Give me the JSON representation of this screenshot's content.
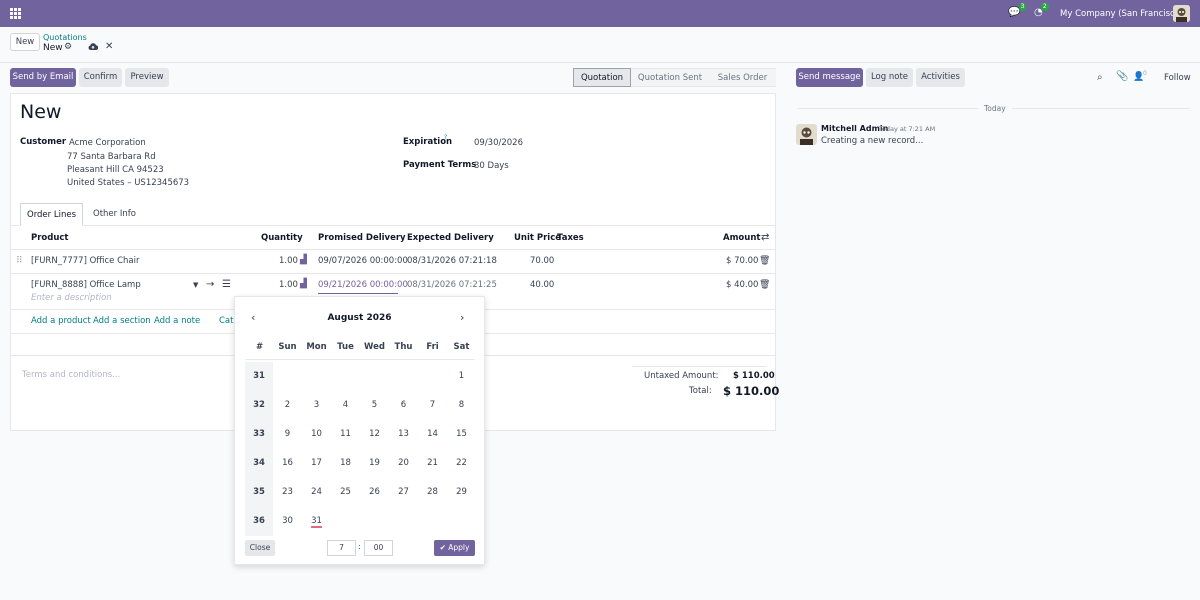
{
  "navbar": {
    "chat_badge": "3",
    "activity_badge": "2",
    "company": "My Company (San Francisco)"
  },
  "control_panel": {
    "new_label": "New",
    "breadcrumb_parent": "Quotations",
    "breadcrumb_current": "New",
    "buttons": {
      "send_email": "Send by Email",
      "confirm": "Confirm",
      "preview": "Preview"
    },
    "status_steps": [
      "Quotation",
      "Quotation Sent",
      "Sales Order"
    ]
  },
  "form": {
    "title": "New",
    "customer_label": "Customer",
    "customer_name": "Acme Corporation",
    "customer_address": [
      "77 Santa Barbara Rd",
      "Pleasant Hill CA 94523",
      "United States – US12345673"
    ],
    "expiration_label": "Expiration",
    "expiration_help": "?",
    "expiration_value": "09/30/2026",
    "payment_terms_label": "Payment Terms",
    "payment_terms_value": "30 Days",
    "tabs": [
      "Order Lines",
      "Other Info"
    ],
    "columns": {
      "product": "Product",
      "quantity": "Quantity",
      "promised": "Promised Delivery",
      "expected": "Expected Delivery",
      "unit_price": "Unit Price",
      "taxes": "Taxes",
      "amount": "Amount"
    },
    "lines": [
      {
        "product": "[FURN_7777] Office Chair",
        "quantity": "1.00",
        "promised": "09/07/2026 00:00:00",
        "expected": "08/31/2026 07:21:18",
        "unit_price": "70.00",
        "amount": "$ 70.00"
      },
      {
        "product": "[FURN_8888] Office Lamp",
        "description_placeholder": "Enter a description",
        "quantity": "1.00",
        "promised": "09/21/2026 00:00:00",
        "expected": "08/31/2026 07:21:25",
        "unit_price": "40.00",
        "amount": "$ 40.00"
      }
    ],
    "add_links": {
      "product": "Add a product",
      "section": "Add a section",
      "note": "Add a note",
      "catalog": "Catalog"
    },
    "terms_placeholder": "Terms and conditions...",
    "untaxed_label": "Untaxed Amount:",
    "untaxed_value": "$ 110.00",
    "total_label": "Total:",
    "total_value": "$ 110.00"
  },
  "chatter": {
    "send_message": "Send message",
    "log_note": "Log note",
    "activities": "Activities",
    "followers_count": "0",
    "follow": "Follow",
    "today": "Today",
    "author": "Mitchell Admin",
    "time": "Today at 7:21 AM",
    "message": "Creating a new record..."
  },
  "datepicker": {
    "month": "August 2026",
    "week_header": "#",
    "days": [
      "Sun",
      "Mon",
      "Tue",
      "Wed",
      "Thu",
      "Fri",
      "Sat"
    ],
    "weeks": [
      {
        "num": "31",
        "days": [
          "",
          "",
          "",
          "",
          "",
          "",
          "1"
        ]
      },
      {
        "num": "32",
        "days": [
          "2",
          "3",
          "4",
          "5",
          "6",
          "7",
          "8"
        ]
      },
      {
        "num": "33",
        "days": [
          "9",
          "10",
          "11",
          "12",
          "13",
          "14",
          "15"
        ]
      },
      {
        "num": "34",
        "days": [
          "16",
          "17",
          "18",
          "19",
          "20",
          "21",
          "22"
        ]
      },
      {
        "num": "35",
        "days": [
          "23",
          "24",
          "25",
          "26",
          "27",
          "28",
          "29"
        ]
      },
      {
        "num": "36",
        "days": [
          "30",
          "31",
          "",
          "",
          "",
          "",
          ""
        ]
      }
    ],
    "today_day": "31",
    "close": "Close",
    "hour": "7",
    "separator": ":",
    "minute": "00",
    "apply": "Apply"
  }
}
